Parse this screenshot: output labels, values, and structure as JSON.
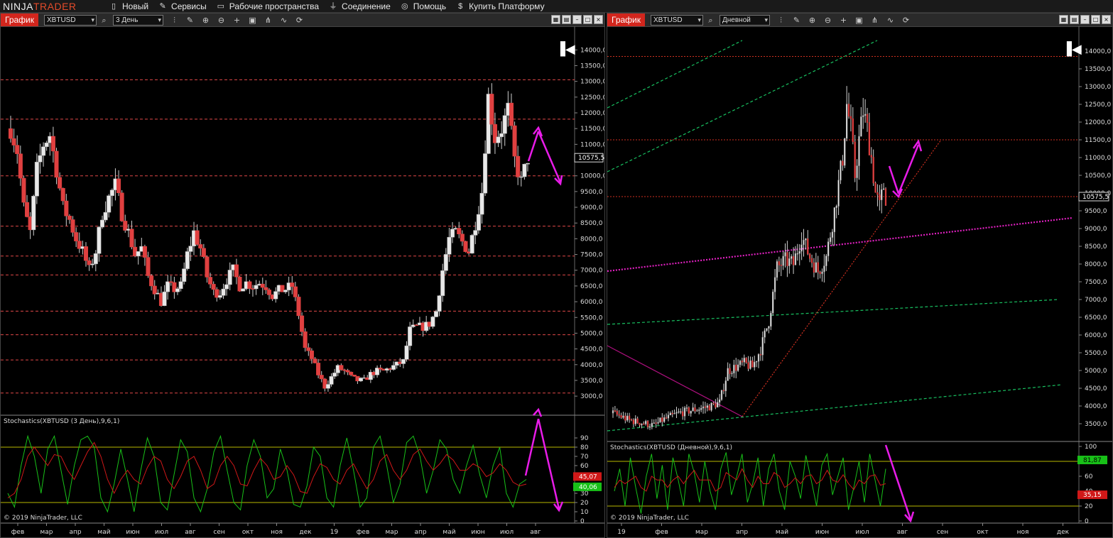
{
  "app": {
    "logo_left": "NINJA",
    "logo_right": "TRADER",
    "menu": [
      {
        "label": "Новый",
        "icon": "new-document-icon"
      },
      {
        "label": "Сервисы",
        "icon": "tools-icon"
      },
      {
        "label": "Рабочие пространства",
        "icon": "workspace-icon"
      },
      {
        "label": "Соединение",
        "icon": "plug-icon"
      },
      {
        "label": "Помощь",
        "icon": "help-icon"
      },
      {
        "label": "Купить Платформу",
        "icon": "dollar-icon"
      }
    ]
  },
  "colors": {
    "up": "#e8e8e8",
    "down": "#e04040",
    "wick": "#cfcfcf",
    "dashed_red": "#e04848",
    "stoch_k": "#18c018",
    "stoch_d": "#d01818",
    "level_line": "#b8b800",
    "arrow": "#e81ce8",
    "green_trend": "#18c060",
    "magenta_dotted": "#e020c0",
    "orange_dotted": "#d03020"
  },
  "left": {
    "tab": "График",
    "instrument": "XBTUSD",
    "interval": "3 День",
    "price_label": "10575,5",
    "stoch_title": "Stochastics(XBTUSD (3 День),9,6,1)",
    "stoch_labels": [
      "45,07",
      "40,06"
    ],
    "copyright": "© 2019 NinjaTrader, LLC",
    "x_labels": [
      "фев",
      "мар",
      "апр",
      "май",
      "июн",
      "июл",
      "авг",
      "сен",
      "окт",
      "ноя",
      "дек",
      "19",
      "фев",
      "мар",
      "апр",
      "май",
      "июн",
      "июл",
      "авг"
    ],
    "price_ticks": [
      "14000,0",
      "13500,0",
      "13000,0",
      "12500,0",
      "12000,0",
      "11500,0",
      "11000,0",
      "10000,0",
      "9500,0",
      "9000,0",
      "8500,0",
      "8000,0",
      "7500,0",
      "7000,0",
      "6500,0",
      "6000,0",
      "5500,0",
      "5000,0",
      "4500,0",
      "4000,0",
      "3500,0",
      "3000,0"
    ],
    "stoch_ticks": [
      "90",
      "80",
      "70",
      "60",
      "50",
      "30",
      "20",
      "10",
      "0"
    ]
  },
  "right": {
    "tab": "График",
    "instrument": "XBTUSD",
    "interval": "Дневной",
    "price_label": "10575,5",
    "stoch_title": "Stochastics(XBTUSD (Дневной),9,6,1)",
    "stoch_labels": [
      "81,87",
      "35,15"
    ],
    "copyright": "© 2019 NinjaTrader, LLC",
    "x_labels": [
      "19",
      "фев",
      "мар",
      "апр",
      "май",
      "июн",
      "июл",
      "авг",
      "сен",
      "окт",
      "ноя",
      "дек"
    ],
    "price_ticks": [
      "14000,0",
      "13500,0",
      "13000,0",
      "12500,0",
      "12000,0",
      "11500,0",
      "11000,0",
      "10500,0",
      "10000,0",
      "9500,0",
      "9000,0",
      "8500,0",
      "8000,0",
      "7500,0",
      "7000,0",
      "6500,0",
      "6000,0",
      "5500,0",
      "5000,0",
      "4500,0",
      "4000,0",
      "3500,0"
    ],
    "stoch_ticks": [
      "100",
      "80",
      "60",
      "40",
      "20",
      "0"
    ]
  },
  "chart_data": [
    {
      "type": "candlestick",
      "title": "XBTUSD 3 День",
      "x_range": [
        "2018-01",
        "2019-08"
      ],
      "ylim": [
        2800,
        14300
      ],
      "levels": [
        13050,
        11800,
        10000,
        8400,
        7450,
        6850,
        5700,
        4950,
        4150,
        3100
      ],
      "close_path": [
        [
          0,
          11500
        ],
        [
          1,
          10800
        ],
        [
          2,
          9000
        ],
        [
          3,
          8200
        ],
        [
          4,
          10200
        ],
        [
          5,
          11000
        ],
        [
          6,
          11300
        ],
        [
          7,
          10200
        ],
        [
          8,
          9000
        ],
        [
          9,
          8600
        ],
        [
          10,
          8000
        ],
        [
          11,
          7600
        ],
        [
          12,
          7000
        ],
        [
          13,
          7600
        ],
        [
          14,
          8800
        ],
        [
          15,
          9300
        ],
        [
          16,
          9700
        ],
        [
          17,
          8800
        ],
        [
          18,
          8200
        ],
        [
          19,
          7500
        ],
        [
          20,
          7700
        ],
        [
          21,
          6800
        ],
        [
          22,
          6400
        ],
        [
          23,
          6000
        ],
        [
          24,
          6500
        ],
        [
          25,
          6400
        ],
        [
          26,
          6500
        ],
        [
          27,
          7500
        ],
        [
          28,
          8200
        ],
        [
          29,
          7700
        ],
        [
          30,
          6800
        ],
        [
          31,
          6300
        ],
        [
          32,
          6300
        ],
        [
          33,
          6700
        ],
        [
          34,
          7000
        ],
        [
          35,
          6500
        ],
        [
          36,
          6600
        ],
        [
          37,
          6500
        ],
        [
          38,
          6600
        ],
        [
          39,
          6500
        ],
        [
          40,
          6200
        ],
        [
          41,
          6350
        ],
        [
          42,
          6400
        ],
        [
          43,
          6500
        ],
        [
          44,
          5600
        ],
        [
          45,
          4500
        ],
        [
          46,
          4200
        ],
        [
          47,
          3700
        ],
        [
          48,
          3300
        ],
        [
          49,
          3600
        ],
        [
          50,
          3900
        ],
        [
          51,
          3800
        ],
        [
          52,
          3600
        ],
        [
          53,
          3500
        ],
        [
          54,
          3500
        ],
        [
          55,
          3700
        ],
        [
          56,
          3800
        ],
        [
          57,
          3800
        ],
        [
          58,
          3900
        ],
        [
          59,
          4000
        ],
        [
          60,
          4100
        ],
        [
          61,
          5100
        ],
        [
          62,
          5200
        ],
        [
          63,
          5200
        ],
        [
          64,
          5300
        ],
        [
          65,
          5700
        ],
        [
          66,
          7000
        ],
        [
          67,
          8000
        ],
        [
          68,
          8200
        ],
        [
          69,
          7900
        ],
        [
          70,
          7600
        ],
        [
          71,
          8500
        ],
        [
          72,
          9500
        ],
        [
          73,
          12500
        ],
        [
          74,
          11200
        ],
        [
          75,
          11500
        ],
        [
          76,
          12100
        ],
        [
          77,
          10500
        ],
        [
          78,
          9800
        ],
        [
          79,
          10575
        ]
      ],
      "stoch_k": [
        30,
        15,
        60,
        92,
        70,
        30,
        78,
        92,
        55,
        18,
        60,
        88,
        92,
        80,
        25,
        10,
        40,
        78,
        45,
        10,
        55,
        90,
        70,
        20,
        12,
        50,
        88,
        75,
        25,
        10,
        35,
        75,
        92,
        55,
        20,
        12,
        60,
        88,
        70,
        25,
        35,
        78,
        55,
        18,
        15,
        38,
        80,
        70,
        25,
        15,
        60,
        90,
        55,
        15,
        25,
        80,
        92,
        60,
        20,
        40,
        85,
        92,
        70,
        30,
        55,
        88,
        78,
        45,
        30,
        60,
        82,
        50,
        25,
        60,
        80,
        30,
        15,
        40,
        45
      ],
      "stoch_d": [
        25,
        30,
        45,
        70,
        80,
        70,
        60,
        72,
        70,
        55,
        45,
        60,
        75,
        85,
        70,
        45,
        30,
        45,
        55,
        45,
        40,
        58,
        70,
        65,
        45,
        35,
        48,
        65,
        70,
        55,
        35,
        40,
        60,
        70,
        60,
        40,
        38,
        55,
        68,
        60,
        45,
        48,
        60,
        50,
        32,
        30,
        48,
        62,
        58,
        45,
        40,
        55,
        62,
        48,
        35,
        45,
        65,
        72,
        55,
        45,
        55,
        72,
        78,
        65,
        55,
        62,
        72,
        66,
        55,
        55,
        62,
        58,
        48,
        52,
        62,
        55,
        42,
        38,
        40
      ],
      "stoch_ylim": [
        0,
        100
      ],
      "stoch_levels": [
        80,
        20
      ]
    },
    {
      "type": "candlestick",
      "title": "XBTUSD Дневной",
      "x_range": [
        "2019-01",
        "2019-12"
      ],
      "ylim": [
        3300,
        14300
      ],
      "levels": [
        13850,
        11500,
        9900
      ],
      "close_path": [
        [
          0,
          3800
        ],
        [
          4,
          3700
        ],
        [
          8,
          3600
        ],
        [
          12,
          3550
        ],
        [
          16,
          3500
        ],
        [
          20,
          3450
        ],
        [
          24,
          3600
        ],
        [
          28,
          3700
        ],
        [
          32,
          3800
        ],
        [
          36,
          3850
        ],
        [
          40,
          3900
        ],
        [
          44,
          3950
        ],
        [
          48,
          4000
        ],
        [
          52,
          4100
        ],
        [
          56,
          5000
        ],
        [
          60,
          5100
        ],
        [
          64,
          5200
        ],
        [
          68,
          5100
        ],
        [
          72,
          5600
        ],
        [
          76,
          6400
        ],
        [
          80,
          7900
        ],
        [
          84,
          8100
        ],
        [
          88,
          8000
        ],
        [
          92,
          8800
        ],
        [
          96,
          8200
        ],
        [
          100,
          7800
        ],
        [
          104,
          8200
        ],
        [
          108,
          9500
        ],
        [
          112,
          11000
        ],
        [
          114,
          12500
        ],
        [
          116,
          11800
        ],
        [
          118,
          10500
        ],
        [
          120,
          11500
        ],
        [
          122,
          12300
        ],
        [
          124,
          11800
        ],
        [
          126,
          11000
        ],
        [
          128,
          10000
        ],
        [
          130,
          9600
        ],
        [
          132,
          10200
        ],
        [
          133,
          9900
        ]
      ],
      "stoch_k": [
        40,
        70,
        20,
        85,
        45,
        10,
        60,
        90,
        30,
        75,
        15,
        85,
        55,
        20,
        90,
        65,
        25,
        80,
        40,
        15,
        70,
        92,
        35,
        60,
        90,
        25,
        50,
        85,
        20,
        70,
        90,
        40,
        15,
        80,
        60,
        30,
        88,
        55,
        20,
        75,
        90,
        35,
        60,
        85,
        15,
        45,
        80,
        25,
        90,
        55,
        20,
        70
      ],
      "stoch_d": [
        45,
        55,
        50,
        55,
        60,
        45,
        40,
        60,
        55,
        55,
        45,
        55,
        60,
        50,
        60,
        68,
        55,
        55,
        55,
        40,
        45,
        65,
        60,
        55,
        70,
        55,
        45,
        60,
        50,
        50,
        65,
        60,
        45,
        50,
        58,
        50,
        60,
        62,
        50,
        55,
        68,
        55,
        52,
        62,
        50,
        42,
        55,
        50,
        60,
        62,
        48,
        50
      ],
      "stoch_ylim": [
        0,
        100
      ],
      "stoch_levels": [
        80,
        20
      ]
    }
  ]
}
